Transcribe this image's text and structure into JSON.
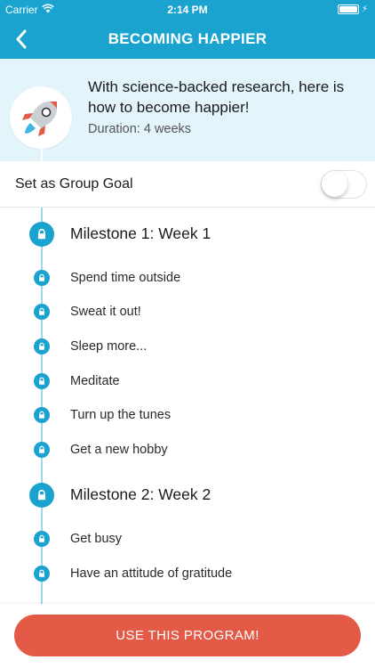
{
  "status_bar": {
    "carrier": "Carrier",
    "time": "2:14 PM",
    "battery_level": 1.0,
    "wifi_icon": "wifi-icon",
    "charging_icon": "bolt-icon"
  },
  "nav": {
    "title": "BECOMING HAPPIER",
    "back_icon": "chevron-left-icon"
  },
  "program": {
    "icon": "rocket-icon",
    "description": "With science-backed research, here is how to become happier!",
    "duration": "Duration: 4 weeks"
  },
  "group_goal": {
    "label": "Set as Group Goal",
    "enabled": false
  },
  "timeline": {
    "rows": [
      {
        "type": "milestone",
        "label": "Milestone 1: Week 1"
      },
      {
        "type": "item",
        "label": "Spend time outside"
      },
      {
        "type": "item",
        "label": "Sweat it out!"
      },
      {
        "type": "item",
        "label": "Sleep more..."
      },
      {
        "type": "item",
        "label": "Meditate"
      },
      {
        "type": "item",
        "label": "Turn up the tunes"
      },
      {
        "type": "item",
        "label": "Get a new hobby"
      },
      {
        "type": "milestone",
        "label": "Milestone 2: Week 2"
      },
      {
        "type": "item",
        "label": "Get busy"
      },
      {
        "type": "item",
        "label": "Have an attitude of gratitude"
      }
    ],
    "lock_icon": "lock-icon"
  },
  "cta": {
    "label": "USE THIS PROGRAM!"
  },
  "colors": {
    "brand": "#1aa3cf",
    "header_bg": "#e3f4fb",
    "cta": "#e35a47",
    "timeline_line": "#9fd7ec"
  }
}
